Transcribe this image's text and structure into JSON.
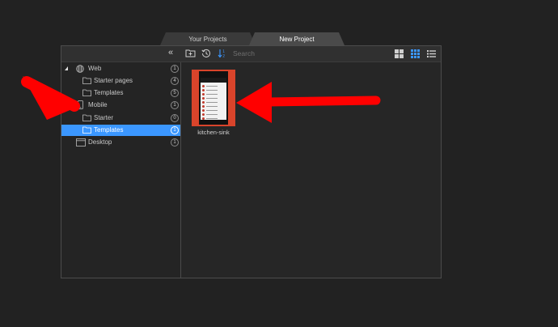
{
  "tabs": [
    {
      "label": "Your Projects"
    },
    {
      "label": "New Project"
    }
  ],
  "toolbar": {
    "collapse_glyph": "«",
    "search_placeholder": "Search"
  },
  "sidebar": {
    "items": [
      {
        "label": "Web",
        "count": "1",
        "icon": "globe-icon"
      },
      {
        "label": "Starter pages",
        "count": "4",
        "icon": "folder-icon"
      },
      {
        "label": "Templates",
        "count": "5",
        "icon": "folder-icon"
      },
      {
        "label": "Mobile",
        "count": "1",
        "icon": "phone-icon"
      },
      {
        "label": "Starter",
        "count": "0",
        "icon": "folder-icon"
      },
      {
        "label": "Templates",
        "count": "1",
        "icon": "folder-icon",
        "selected": true
      },
      {
        "label": "Desktop",
        "count": "1",
        "icon": "window-icon"
      }
    ]
  },
  "content": {
    "items": [
      {
        "label": "kitchen-sink"
      }
    ]
  },
  "colors": {
    "accent": "#3b97ff",
    "arrow": "#ff0000",
    "thumb_bg": "#d9442b"
  }
}
